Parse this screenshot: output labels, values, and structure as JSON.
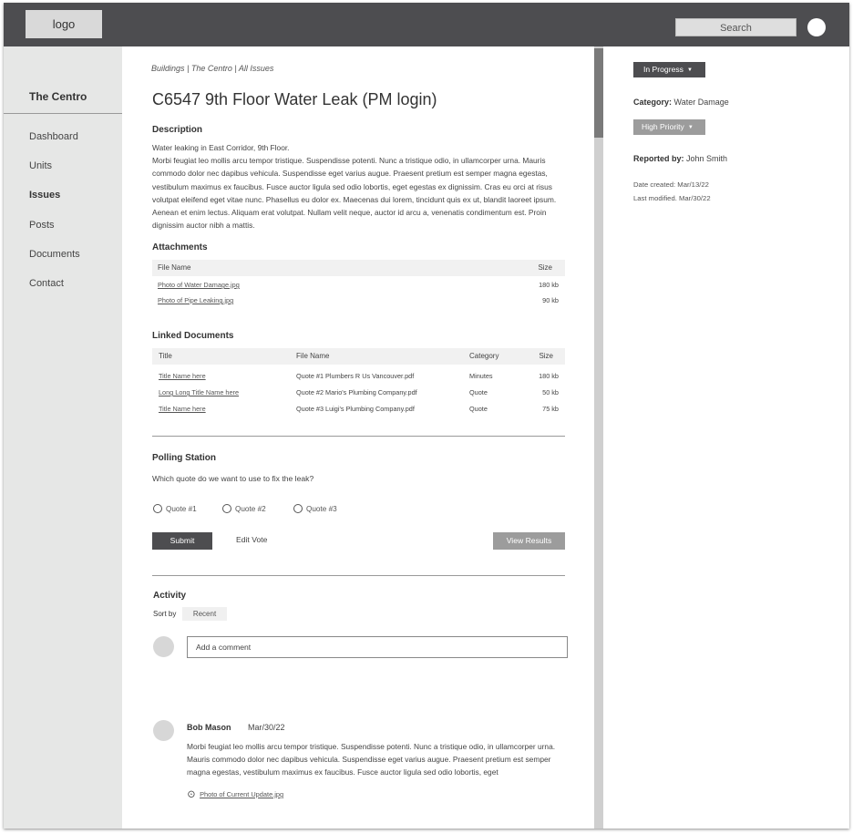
{
  "header": {
    "logo": "logo",
    "search_label": "Search"
  },
  "sidebar": {
    "building": "The Centro",
    "items": [
      {
        "label": "Dashboard"
      },
      {
        "label": "Units"
      },
      {
        "label": "Issues"
      },
      {
        "label": "Posts"
      },
      {
        "label": "Documents"
      },
      {
        "label": "Contact"
      }
    ],
    "active_item": "Issues"
  },
  "main": {
    "breadcrumb": "Buildings | The Centro | All Issues",
    "title": "C6547 9th Floor Water Leak (PM login)",
    "description": {
      "heading": "Description",
      "line1": "Water leaking in East Corridor, 9th Floor.",
      "body": "Morbi feugiat leo mollis arcu tempor tristique. Suspendisse potenti. Nunc a tristique odio, in ullamcorper urna. Mauris commodo dolor nec dapibus vehicula. Suspendisse eget varius augue. Praesent pretium est semper magna egestas, vestibulum maximus ex faucibus. Fusce auctor ligula sed odio lobortis, eget egestas ex dignissim. Cras eu orci at risus volutpat eleifend eget vitae nunc. Phasellus eu dolor ex. Maecenas dui lorem, tincidunt quis ex ut, blandit laoreet ipsum. Aenean et enim lectus. Aliquam erat volutpat. Nullam velit neque, auctor id arcu a, venenatis condimentum est. Proin dignissim auctor nibh a mattis."
    },
    "attachments": {
      "heading": "Attachments",
      "columns": {
        "file_name": "File Name",
        "size": "Size"
      },
      "rows": [
        {
          "file": "Photo of Water Damage.jpg",
          "size": "180 kb"
        },
        {
          "file": "Photo of Pipe Leaking.jpg",
          "size": "90 kb"
        }
      ]
    },
    "linked_documents": {
      "heading": "Linked Documents",
      "columns": {
        "title": "Title",
        "file_name": "File Name",
        "category": "Category",
        "size": "Size"
      },
      "rows": [
        {
          "title": "Title Name here",
          "file": "Quote #1 Plumbers R Us Vancouver.pdf",
          "category": "Minutes",
          "size": "180 kb"
        },
        {
          "title": "Long Long Title Name here",
          "file": "Quote #2 Mario's Plumbing Company.pdf",
          "category": "Quote",
          "size": "50 kb"
        },
        {
          "title": "Title Name here",
          "file": "Quote #3 Luigi's Plumbing Company.pdf",
          "category": "Quote",
          "size": "75 kb"
        }
      ]
    },
    "poll": {
      "heading": "Polling Station",
      "question": "Which quote do we want to use to fix the leak?",
      "options": [
        "Quote #1",
        "Quote #2",
        "Quote #3"
      ],
      "submit_label": "Submit",
      "edit_label": "Edit Vote",
      "results_label": "View Results"
    },
    "activity": {
      "heading": "Activity",
      "sort_label": "Sort by",
      "sort_value": "Recent",
      "comment_placeholder": "Add a comment",
      "comments": [
        {
          "author": "Bob Mason",
          "date": "Mar/30/22",
          "body": "Morbi feugiat leo mollis arcu tempor tristique. Suspendisse potenti. Nunc a tristique odio, in ullamcorper urna. Mauris commodo dolor nec dapibus vehicula. Suspendisse eget varius augue. Praesent pretium est semper magna egestas, vestibulum maximus ex faucibus. Fusce auctor ligula sed odio lobortis, eget",
          "attachment": "Photo of Current Update.jpg"
        }
      ]
    }
  },
  "right_panel": {
    "status": "In Progress",
    "category_label": "Category:",
    "category_value": "Water Damage",
    "priority": "High Priority",
    "reported_label": "Reported by:",
    "reported_value": "John Smith",
    "date_created_label": "Date created:",
    "date_created_value": "Mar/13/22",
    "last_modified_label": "Last modified.",
    "last_modified_value": "Mar/30/22"
  },
  "icons": {
    "dropdown": "caret-down-icon",
    "attachment": "paperclip-icon",
    "user": "avatar"
  }
}
